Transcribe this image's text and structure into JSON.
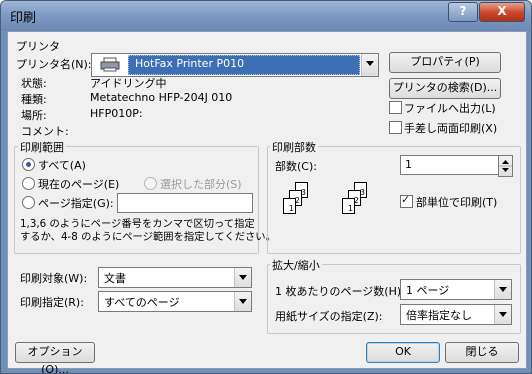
{
  "window": {
    "title": "印刷",
    "help_label": "?",
    "close_label": "X"
  },
  "printer": {
    "group_label": "プリンタ",
    "name_label": "プリンタ名(N):",
    "selected": "HotFax Printer P010",
    "status_label": "状態:",
    "status_value": "アイドリング中",
    "type_label": "種類:",
    "type_value": "Metatechno HFP-204J 010",
    "location_label": "場所:",
    "location_value": "HFP010P:",
    "comment_label": "コメント:",
    "properties_button": "プロパティ(P)",
    "search_button": "プリンタの検索(D)...",
    "print_to_file": {
      "label": "ファイルへ出力(L)",
      "checked": false
    },
    "manual_duplex": {
      "label": "手差し両面印刷(X)",
      "checked": false
    }
  },
  "range": {
    "group_label": "印刷範囲",
    "all_label": "すべて(A)",
    "current_page_label": "現在のページ(E)",
    "selection_label": "選択した部分(S)",
    "pages_label": "ページ指定(G):",
    "pages_value": "",
    "help_text_1": "1,3,6 のようにページ番号をカンマで区切って指定",
    "help_text_2": "するか、4-8 のようにページ範囲を指定してください。",
    "selected": "all"
  },
  "copies": {
    "group_label": "印刷部数",
    "count_label": "部数(C):",
    "count_value": "1",
    "collate_label": "部単位で印刷(T)",
    "collate_checked": true,
    "collate_pages": [
      "1",
      "2",
      "3",
      "1",
      "2",
      "3"
    ]
  },
  "print_what": {
    "label": "印刷対象(W):",
    "value": "文書"
  },
  "print_pages": {
    "label": "印刷指定(R):",
    "value": "すべてのページ"
  },
  "zoom": {
    "group_label": "拡大/縮小",
    "pages_per_sheet_label": "1 枚あたりのページ数(H):",
    "pages_per_sheet_value": "1 ページ",
    "scale_label": "用紙サイズの指定(Z):",
    "scale_value": "倍率指定なし"
  },
  "footer": {
    "options_button": "オプション(O)...",
    "ok_button": "OK",
    "close_button": "閉じる"
  }
}
